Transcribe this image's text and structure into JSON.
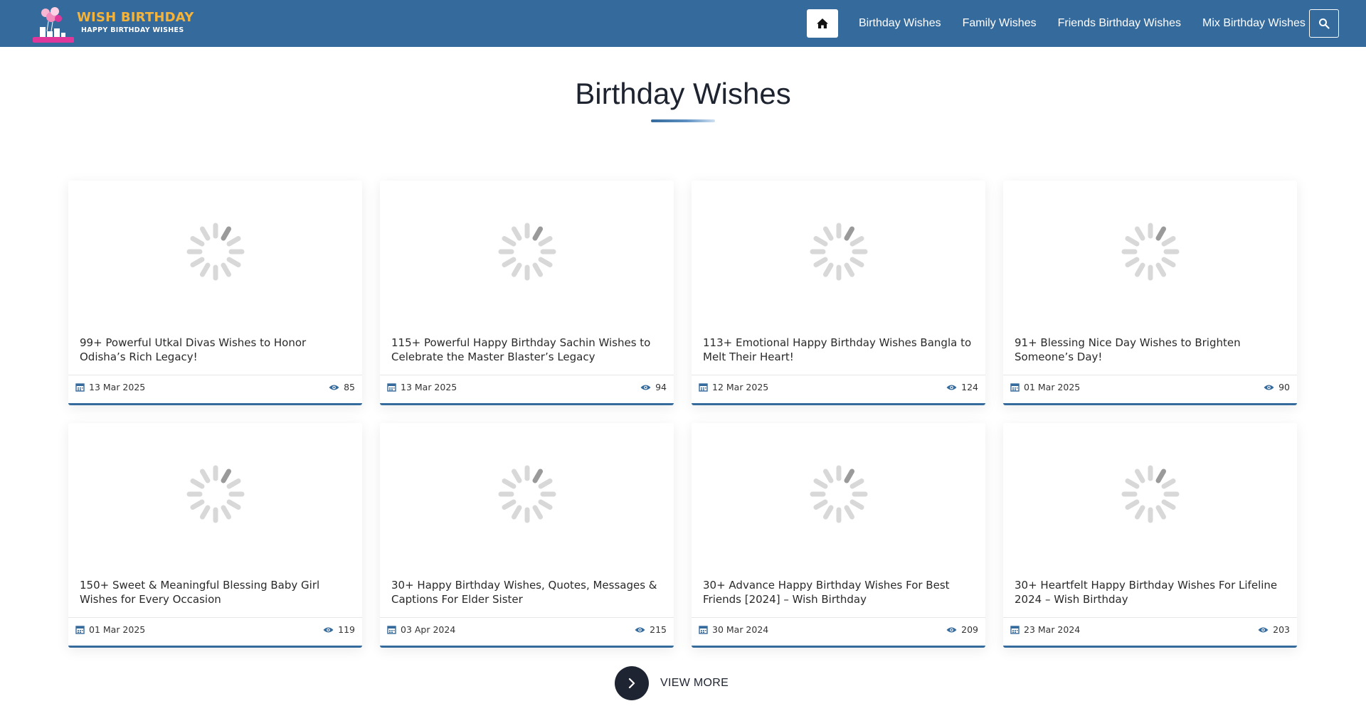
{
  "header": {
    "logo_title": "WISH BIRTHDAY",
    "logo_subtitle": "HAPPY BIRTHDAY WISHES",
    "nav": [
      {
        "label": "Birthday Wishes"
      },
      {
        "label": "Family Wishes"
      },
      {
        "label": "Friends Birthday Wishes"
      },
      {
        "label": "Mix Birthday Wishes"
      }
    ],
    "home_icon": "home-icon",
    "search_icon": "search-icon"
  },
  "page": {
    "title": "Birthday Wishes"
  },
  "cards": [
    {
      "title": "99+ Powerful Utkal Divas Wishes to Honor Odisha’s Rich Legacy!",
      "date": "13 Mar 2025",
      "views": "85"
    },
    {
      "title": "115+ Powerful Happy Birthday Sachin Wishes to Celebrate the Master Blaster’s Legacy",
      "date": "13 Mar 2025",
      "views": "94"
    },
    {
      "title": "113+ Emotional Happy Birthday Wishes Bangla to Melt Their Heart!",
      "date": "12 Mar 2025",
      "views": "124"
    },
    {
      "title": "91+ Blessing Nice Day Wishes to Brighten Someone’s Day!",
      "date": "01 Mar 2025",
      "views": "90"
    },
    {
      "title": "150+ Sweet & Meaningful Blessing Baby Girl Wishes for Every Occasion",
      "date": "01 Mar 2025",
      "views": "119"
    },
    {
      "title": "30+ Happy Birthday Wishes, Quotes, Messages & Captions For Elder Sister",
      "date": "03 Apr 2024",
      "views": "215"
    },
    {
      "title": "30+ Advance Happy Birthday Wishes For Best Friends [2024] – Wish Birthday",
      "date": "30 Mar 2024",
      "views": "209"
    },
    {
      "title": "30+ Heartfelt Happy Birthday Wishes For Lifeline 2024 – Wish Birthday",
      "date": "23 Mar 2024",
      "views": "203"
    }
  ],
  "view_more": {
    "label": "VIEW MORE",
    "icon": "chevron-right-icon"
  },
  "colors": {
    "header_bg": "#356a9c",
    "logo_title": "#f4b33a",
    "accent": "#356a9c",
    "dark": "#1f2433"
  }
}
